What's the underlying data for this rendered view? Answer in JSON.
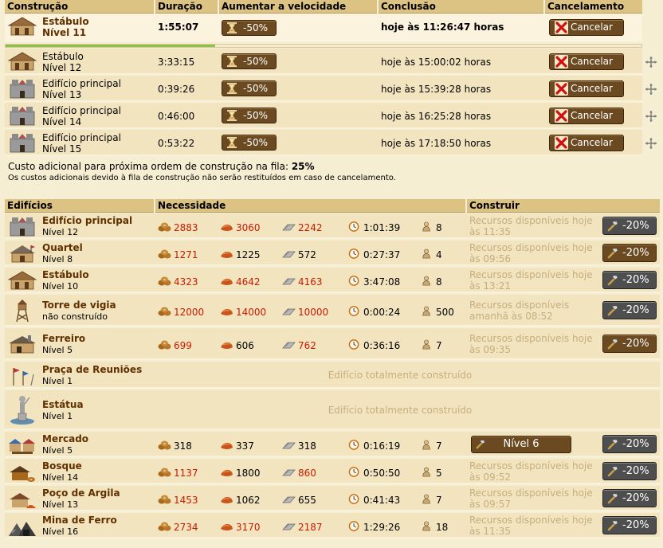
{
  "queue": {
    "headers": {
      "construction": "Construção",
      "duration": "Duração",
      "speed": "Aumentar a velocidade",
      "completion": "Conclusão",
      "cancel": "Cancelamento"
    },
    "speed_label": "-50%",
    "cancel_label": "Cancelar",
    "progress": 0.33,
    "items": [
      {
        "name": "Estábulo",
        "level": "Nível 11",
        "duration": "1:55:07",
        "completion": "hoje às 11:26:47 horas",
        "current": true,
        "icon": "stable-building-icon"
      },
      {
        "name": "Estábulo",
        "level": "Nível 12",
        "duration": "3:33:15",
        "completion": "hoje às 15:00:02 horas",
        "icon": "stable-building-icon"
      },
      {
        "name": "Edifício principal",
        "level": "Nível 13",
        "duration": "0:39:26",
        "completion": "hoje às 15:39:28 horas",
        "icon": "main-building-icon"
      },
      {
        "name": "Edifício principal",
        "level": "Nível 14",
        "duration": "0:46:00",
        "completion": "hoje às 16:25:28 horas",
        "icon": "main-building-icon"
      },
      {
        "name": "Edifício principal",
        "level": "Nível 15",
        "duration": "0:53:22",
        "completion": "hoje às 17:18:50 horas",
        "icon": "main-building-icon"
      }
    ],
    "extra_cost_text": "Custo adicional para próxima ordem de construção na fila: ",
    "extra_cost_value": "25%",
    "refund_note": "Os custos adicionais devido à fila de construção não serão restituídos em caso de cancelamento."
  },
  "buildings": {
    "headers": {
      "buildings": "Edifícios",
      "requirement": "Necessidade",
      "build": "Construir"
    },
    "discount_label": "-20%",
    "fully_built": "Edifício totalmente construído",
    "colors": {
      "insufficient": "#c81a00",
      "wood": "#a8681c",
      "clay": "#c8561c",
      "iron": "#888888"
    },
    "rows": [
      {
        "name": "Edifício principal",
        "level": "Nível 12",
        "wood": "2883",
        "clay": "3060",
        "iron": "2242",
        "time": "1:01:39",
        "pop": "8",
        "wood_short": true,
        "clay_short": true,
        "iron_short": true,
        "avail1": "Recursos disponíveis hoje",
        "avail2": "às 11:35",
        "icon": "main-building-icon"
      },
      {
        "name": "Quartel",
        "level": "Nível 8",
        "wood": "1271",
        "clay": "1225",
        "iron": "572",
        "time": "0:27:37",
        "pop": "4",
        "wood_short": true,
        "clay_short": false,
        "iron_short": false,
        "avail1": "Recursos disponíveis hoje",
        "avail2": "às 09:56",
        "icon": "barracks-icon"
      },
      {
        "name": "Estábulo",
        "level": "Nível 10",
        "wood": "4323",
        "clay": "4642",
        "iron": "4163",
        "time": "3:47:08",
        "pop": "8",
        "wood_short": true,
        "clay_short": true,
        "iron_short": true,
        "avail1": "Recursos disponíveis hoje",
        "avail2": "às 13:21",
        "icon": "stable-building-icon"
      },
      {
        "name": "Torre de vigia",
        "level": "não construído",
        "wood": "12000",
        "clay": "14000",
        "iron": "10000",
        "time": "0:00:24",
        "pop": "500",
        "wood_short": true,
        "clay_short": true,
        "iron_short": true,
        "avail1": "Recursos disponíveis",
        "avail2": "amanhã às 08:52",
        "icon": "watchtower-icon"
      },
      {
        "name": "Ferreiro",
        "level": "Nível 5",
        "wood": "699",
        "clay": "606",
        "iron": "762",
        "time": "0:36:16",
        "pop": "7",
        "wood_short": true,
        "clay_short": false,
        "iron_short": true,
        "avail1": "Recursos disponíveis hoje",
        "avail2": "às 09:35",
        "icon": "smithy-icon"
      },
      {
        "name": "Praça de Reuniões",
        "level": "Nível 1",
        "full": true,
        "icon": "rally-point-icon"
      },
      {
        "name": "Estátua",
        "level": "Nível 1",
        "full": true,
        "icon": "statue-icon"
      },
      {
        "name": "Mercado",
        "level": "Nível 5",
        "wood": "318",
        "clay": "337",
        "iron": "318",
        "time": "0:16:19",
        "pop": "7",
        "wood_short": false,
        "clay_short": false,
        "iron_short": false,
        "level_button": "Nível 6",
        "icon": "market-icon"
      },
      {
        "name": "Bosque",
        "level": "Nível 14",
        "wood": "1137",
        "clay": "1800",
        "iron": "860",
        "time": "0:50:50",
        "pop": "5",
        "wood_short": true,
        "clay_short": false,
        "iron_short": true,
        "avail1": "Recursos disponíveis hoje",
        "avail2": "às 09:52",
        "icon": "timber-camp-icon"
      },
      {
        "name": "Poço de Argila",
        "level": "Nível 13",
        "wood": "1453",
        "clay": "1062",
        "iron": "655",
        "time": "0:41:43",
        "pop": "7",
        "wood_short": true,
        "clay_short": false,
        "iron_short": false,
        "avail1": "Recursos disponíveis hoje",
        "avail2": "às 09:57",
        "icon": "clay-pit-icon"
      },
      {
        "name": "Mina de Ferro",
        "level": "Nível 16",
        "wood": "2734",
        "clay": "3170",
        "iron": "2187",
        "time": "1:29:26",
        "pop": "18",
        "wood_short": true,
        "clay_short": true,
        "iron_short": true,
        "avail1": "Recursos disponíveis hoje",
        "avail2": "às 11:35",
        "icon": "iron-mine-icon"
      }
    ]
  }
}
